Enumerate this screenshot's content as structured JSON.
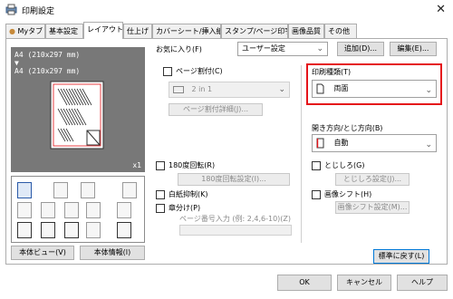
{
  "window": {
    "title": "印刷設定"
  },
  "tabs": [
    {
      "label": "Myタブ"
    },
    {
      "label": "基本設定"
    },
    {
      "label": "レイアウト"
    },
    {
      "label": "仕上げ"
    },
    {
      "label": "カバーシート/挿入紙"
    },
    {
      "label": "スタンプ/ページ印字"
    },
    {
      "label": "画像品質"
    },
    {
      "label": "その他"
    }
  ],
  "preview": {
    "line1": "A4 (210x297 mm)",
    "arrow": "▼",
    "line2": "A4 (210x297 mm)",
    "count": "x1"
  },
  "left_buttons": {
    "printer_view": "本体ビュー(V)",
    "printer_info": "本体情報(I)"
  },
  "favorites": {
    "label": "お気に入り(F)",
    "value": "ユーザー設定",
    "add_button": "追加(D)...",
    "edit_button": "編集(E)..."
  },
  "combine": {
    "label": "ページ割付(C)",
    "value": "2 in 1",
    "details_button": "ページ割付詳細(J)..."
  },
  "rotate180": {
    "label": "180度回転(R)",
    "details_button": "180度回転設定(I)..."
  },
  "blank_suppress": {
    "label": "白紙抑制(K)"
  },
  "chapter": {
    "label": "章分け(P)",
    "field_label": "ページ番号入力 (例: 2,4,6-10)(Z)"
  },
  "print_type": {
    "label": "印刷種類(T)",
    "value": "両面"
  },
  "binding": {
    "label": "開き方向/とじ方向(B)",
    "value": "自動"
  },
  "margin": {
    "label": "とじしろ(G)",
    "button": "とじしろ設定(J)..."
  },
  "image_shift": {
    "label": "画像シフト(H)",
    "button": "画像シフト設定(M)..."
  },
  "restore_button": "標準に戻す(L)",
  "dialog_buttons": {
    "ok": "OK",
    "cancel": "キャンセル",
    "help": "ヘルプ"
  },
  "colors": {
    "highlight": "#e5141a",
    "preview_bg": "#787878"
  }
}
